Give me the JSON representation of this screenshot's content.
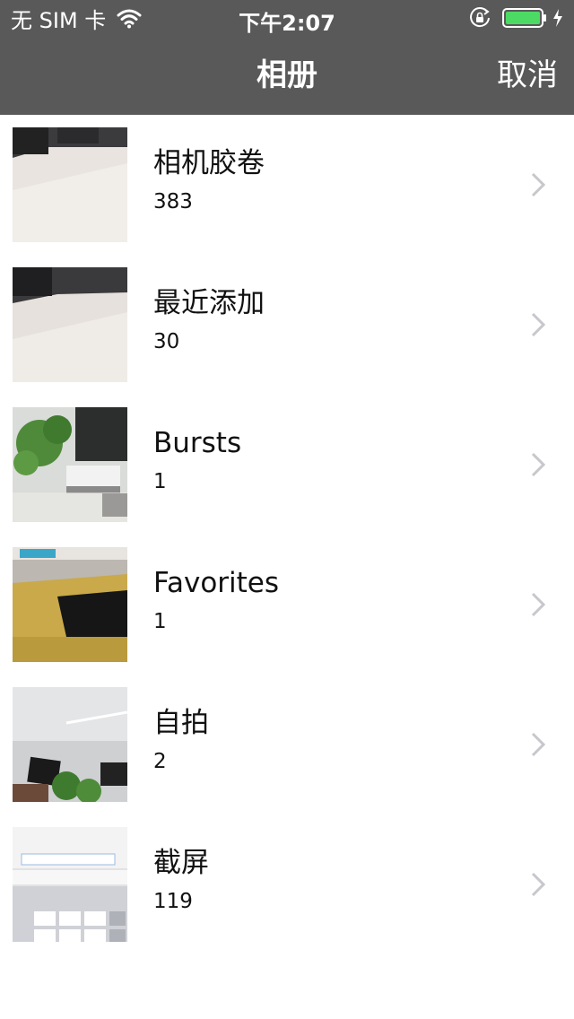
{
  "status_bar": {
    "carrier": "无 SIM 卡",
    "time": "下午2:07",
    "icons": [
      "wifi-icon",
      "rotation-lock-icon",
      "battery-icon",
      "charging-icon"
    ],
    "battery_color": "#4cd964"
  },
  "nav": {
    "title": "相册",
    "cancel_label": "取消"
  },
  "albums": [
    {
      "name": "相机胶卷",
      "count": "383"
    },
    {
      "name": "最近添加",
      "count": "30"
    },
    {
      "name": "Bursts",
      "count": "1"
    },
    {
      "name": "Favorites",
      "count": "1"
    },
    {
      "name": "自拍",
      "count": "2"
    },
    {
      "name": "截屏",
      "count": "119"
    }
  ],
  "colors": {
    "header_bg": "#595959",
    "header_text": "#ffffff",
    "chevron": "#c7c7cc"
  }
}
